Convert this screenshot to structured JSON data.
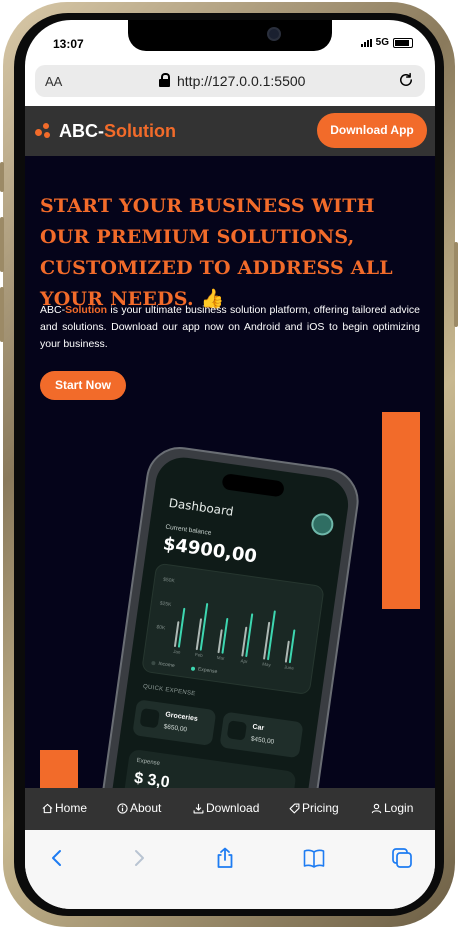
{
  "status_bar": {
    "time": "13:07",
    "network": "5G"
  },
  "browser": {
    "aa_label": "AA",
    "url": "http://127.0.0.1:5500"
  },
  "header": {
    "logo_prefix": "ABC-",
    "logo_accent": "Solution",
    "download_button": "Download App"
  },
  "hero": {
    "title": "START YOUR BUSINESS WITH OUR PREMIUM SOLUTIONS, CUSTOMIZED TO ADDRESS ALL YOUR NEEDS. 👍",
    "desc_prefix": "ABC-",
    "desc_accent": "Solution",
    "desc_body": " is your ultimate business solution platform, offering tailored advice and solutions. Download our app now on Android and iOS to begin optimizing your business.",
    "start_button": "Start Now"
  },
  "mockup": {
    "title": "Dashboard",
    "balance_label": "Current balance",
    "balance": "$4900,00",
    "y_labels": [
      "$50K",
      "$25K",
      "$0K"
    ],
    "x_labels": [
      "Jan",
      "Feb",
      "Mar",
      "Apr",
      "May",
      "June"
    ],
    "legend": [
      "Income",
      "Expense"
    ],
    "quick_expense_label": "QUICK EXPENSE",
    "cards": [
      {
        "name": "Groceries",
        "amount": "$650,00"
      },
      {
        "name": "Car",
        "amount": "$450,00"
      }
    ],
    "expense_label": "Expense",
    "expense_value": "$ 3,0"
  },
  "nav": {
    "items": [
      "Home",
      "About",
      "Download",
      "Pricing",
      "Login"
    ]
  },
  "colors": {
    "accent": "#f26b2a",
    "header_bg": "#333333",
    "hero_bg": "#05041a",
    "income": "#3dd6b0"
  }
}
